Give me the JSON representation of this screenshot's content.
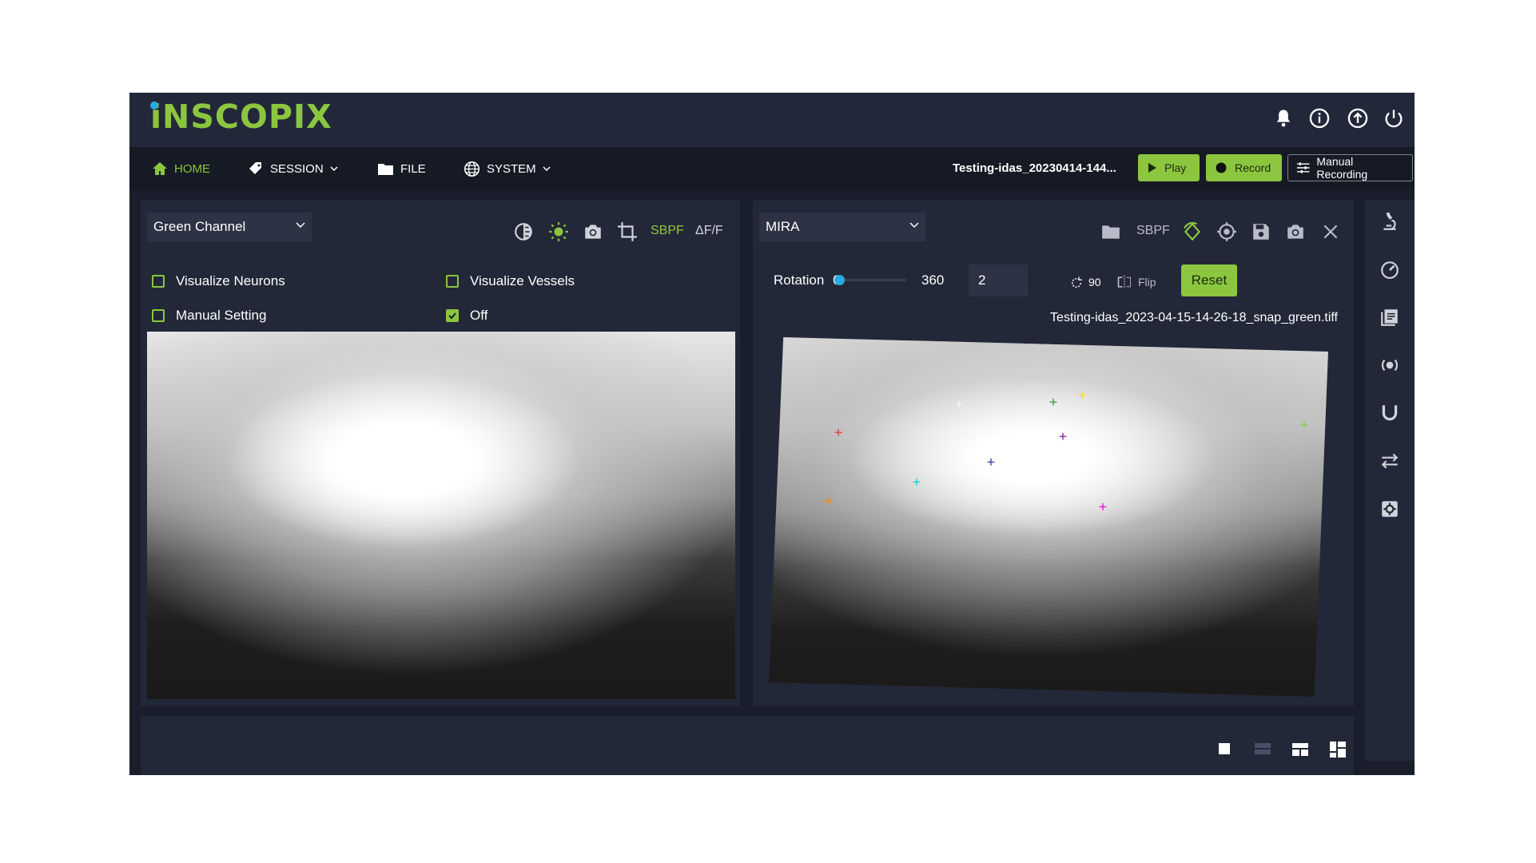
{
  "app": {
    "logo_text": "iNSCOPIX",
    "brand_color": "#8cc63f",
    "accent_blue": "#29abe2"
  },
  "header": {
    "icons": [
      "bell-icon",
      "info-icon",
      "upload-icon",
      "power-icon"
    ]
  },
  "nav": {
    "home": "HOME",
    "session": "SESSION",
    "file": "FILE",
    "system": "SYSTEM",
    "session_name": "Testing-idas_20230414-144...",
    "play_label": "Play",
    "record_label": "Record",
    "manual_recording_label": "Manual Recording"
  },
  "left_panel": {
    "channel": "Green Channel",
    "sbpf_label": "SBPF",
    "dff_label": "ΔF/F",
    "checkboxes": [
      {
        "label": "Visualize Neurons",
        "checked": false
      },
      {
        "label": "Visualize Vessels",
        "checked": false
      },
      {
        "label": "Manual Setting",
        "checked": false
      },
      {
        "label": "Off",
        "checked": true
      }
    ]
  },
  "right_panel": {
    "source": "MIRA",
    "sbpf_label": "SBPF",
    "rotation_label": "Rotation",
    "rotation_value": "0",
    "rotation_fraction": 0,
    "rotation_max": "360",
    "step_value": "2",
    "rotate_step": "90",
    "flip_label": "Flip",
    "reset_label": "Reset",
    "filename": "Testing-idas_2023-04-15-14-26-18_snap_green.tiff",
    "markers": [
      {
        "color": "#e53935"
      },
      {
        "color": "#f5f5f5"
      },
      {
        "color": "#43a047"
      },
      {
        "color": "#fdd835"
      },
      {
        "color": "#8e24aa"
      },
      {
        "color": "#3949ab"
      },
      {
        "color": "#26c6da"
      },
      {
        "color": "#fb8c00"
      },
      {
        "color": "#d81bd8"
      },
      {
        "color": "#7cd33d"
      }
    ]
  },
  "rail": {
    "icons": [
      "microscope-icon",
      "gauge-icon",
      "notes-icon",
      "broadcast-icon",
      "magnet-icon",
      "swap-icon",
      "settings-gear-icon"
    ]
  },
  "layout_buttons": [
    "single-layout-icon",
    "rows-layout-icon",
    "split-layout-icon",
    "grid-layout-icon"
  ]
}
